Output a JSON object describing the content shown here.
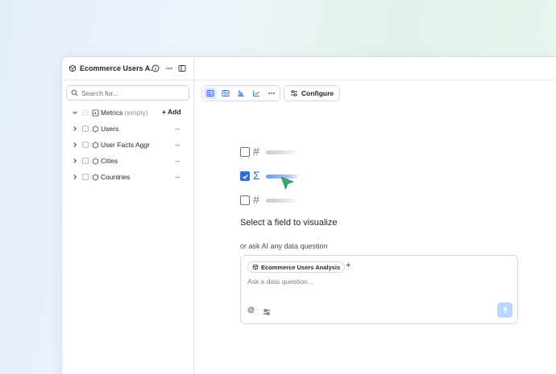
{
  "sidebar": {
    "title": "Ecommerce Users A...",
    "search_placeholder": "Search for...",
    "items": [
      {
        "label": "Metrics",
        "suffix": "(empty)",
        "action": "+ Add",
        "expanded": true
      },
      {
        "label": "Users",
        "action": "..."
      },
      {
        "label": "User Facts Aggr",
        "action": "..."
      },
      {
        "label": "Cities",
        "action": "..."
      },
      {
        "label": "Countries",
        "action": "..."
      }
    ]
  },
  "toolbar": {
    "views": [
      "table-icon",
      "pivot-icon",
      "bar-chart-icon",
      "line-chart-icon",
      "more-icon"
    ],
    "active_view": "table-icon",
    "configure_label": "Configure"
  },
  "empty_state": {
    "headline": "Select a field to visualize",
    "subhead": "or ask AI any data question"
  },
  "ask": {
    "chip_label": "Ecommerce Users Analysis",
    "placeholder": "Ask a data question...",
    "at_symbol": "@"
  },
  "colors": {
    "accent": "#2f6fd6",
    "send_button": "#b9d6fb",
    "cursor": "#3aa76d"
  }
}
